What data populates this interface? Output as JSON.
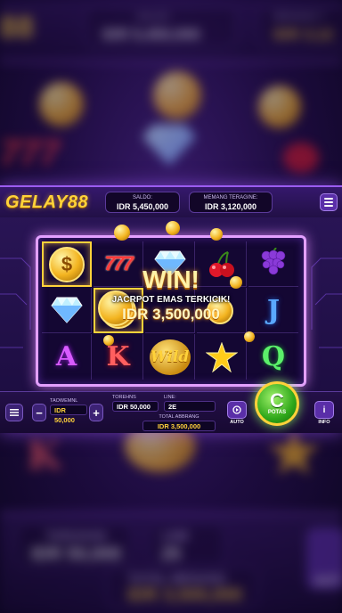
{
  "header": {
    "logo": "GELAY88",
    "saldo_label": "SALDO:",
    "saldo_value": "IDR 5,450,000",
    "win_label": "MEMANG TERAGINE:",
    "win_value": "IDR 3,120,000"
  },
  "backdrop": {
    "logo_fragment": "88",
    "saldo_label": "SALDO",
    "saldo_value": "IDR 5,450,000",
    "win_label": "MENANG T",
    "win_value": "IDR 3,12",
    "bet_label": "TARUHAN",
    "bet_value": "IDR 50,000",
    "line_label": "LINE",
    "line_value": "25",
    "total_label": "TOTAL MENANG",
    "total_value": "IDR 3,500,000",
    "auto_label": "AUT"
  },
  "reels": {
    "rows": [
      [
        "coin",
        "777",
        "diamond",
        "cherry",
        "grapes"
      ],
      [
        "diamond",
        "coin",
        "",
        "",
        "J"
      ],
      [
        "A",
        "K",
        "Wild",
        "star",
        "Q"
      ]
    ],
    "wild_label": "Wild"
  },
  "win": {
    "title": "WIN!",
    "subtitle": "JACRPOT EMAS TERKICIK!",
    "amount": "IDR 3,500,000"
  },
  "controls": {
    "bet_label": "TAOWEMNL",
    "bet_value": "IDR 50,000",
    "minus": "−",
    "plus": "+",
    "bet2_label": "TOREHNS",
    "bet2_value": "IDR 50,000",
    "line_label": "LINE:",
    "line_value": "2E",
    "total_label": "TOTAL ABBRANG",
    "total_value": "IDR 3,500,000",
    "auto_label": "AUTO",
    "spin_glyph": "C",
    "spin_label": "POTAS",
    "info_label": "INFO",
    "info_glyph": "i"
  },
  "colors": {
    "accent": "#9b5cf0",
    "gold": "#ffd23a",
    "spin_green": "#2fa81a"
  }
}
